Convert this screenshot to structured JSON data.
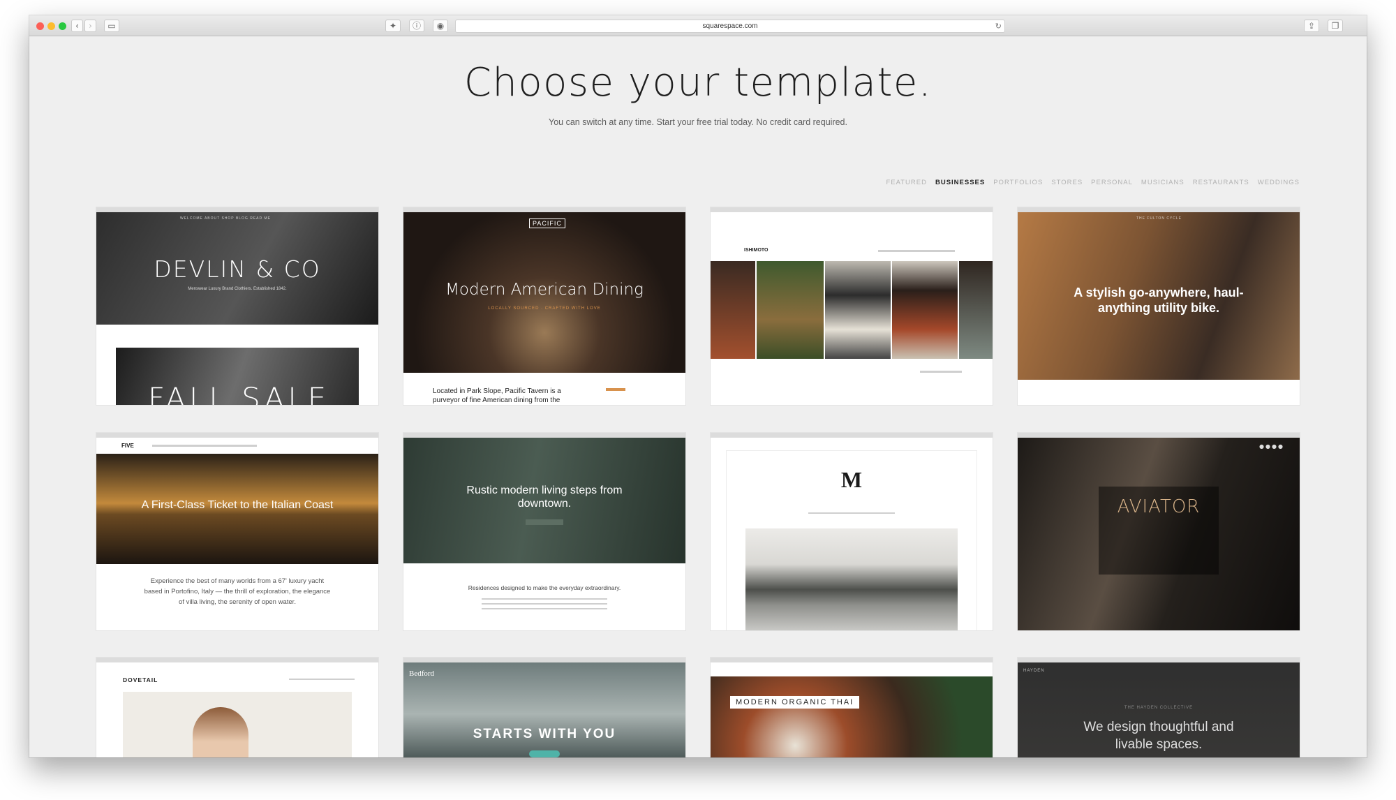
{
  "browser": {
    "url": "squarespace.com",
    "back_icon": "chevron-left-icon",
    "forward_icon": "chevron-right-icon",
    "sidebar_icon": "sidebar-icon",
    "reload_icon": "reload-icon",
    "share_icon": "share-icon",
    "tabs_icon": "tabs-icon"
  },
  "page": {
    "title": "Choose your template.",
    "subtitle": "You can switch at any time. Start your free trial today. No credit card required."
  },
  "filters": [
    {
      "label": "FEATURED",
      "active": false
    },
    {
      "label": "BUSINESSES",
      "active": true
    },
    {
      "label": "PORTFOLIOS",
      "active": false
    },
    {
      "label": "STORES",
      "active": false
    },
    {
      "label": "PERSONAL",
      "active": false
    },
    {
      "label": "MUSICIANS",
      "active": false
    },
    {
      "label": "RESTAURANTS",
      "active": false
    },
    {
      "label": "WEDDINGS",
      "active": false
    }
  ],
  "templates": {
    "devlin": {
      "nav": "WELCOME   ABOUT   SHOP   BLOG   READ ME",
      "title": "DEVLIN & CO",
      "tagline": "Menswear Luxury Brand Clothiers. Established 1842.",
      "banner": "FALL SALE"
    },
    "pacific": {
      "logo": "PACIFIC",
      "title": "Modern American Dining",
      "tagline": "LOCALLY SOURCED · CRAFTED WITH LOVE",
      "body": "Located in Park Slope, Pacific Tavern is a purveyor of fine American dining from the"
    },
    "ishimoto": {
      "logo": "ISHIMOTO"
    },
    "fulton": {
      "nav": "THE FULTON CYCLE",
      "headline": "A stylish go-anywhere, haul-anything utility bike."
    },
    "five": {
      "logo": "FIVE",
      "headline": "A First-Class Ticket to the Italian Coast",
      "body": "Experience the best of many worlds from a 67' luxury yacht based in Portofino, Italy — the thrill of exploration, the elegance of villa living, the serenity of open water."
    },
    "rustic": {
      "headline": "Rustic modern living steps from downtown.",
      "body": "Residences designed to make the everyday extraordinary."
    },
    "marta": {
      "logo": "M"
    },
    "aviator": {
      "title": "AVIATOR"
    },
    "dovetail": {
      "logo": "DOVETAIL"
    },
    "bedford": {
      "logo": "Bedford",
      "headline": "STARTS WITH YOU"
    },
    "marquee": {
      "headline": "MODERN ORGANIC THAI"
    },
    "hayden": {
      "logo": "HAYDEN",
      "kicker": "THE HAYDEN COLLECTIVE",
      "headline": "We design thoughtful and livable spaces."
    }
  }
}
